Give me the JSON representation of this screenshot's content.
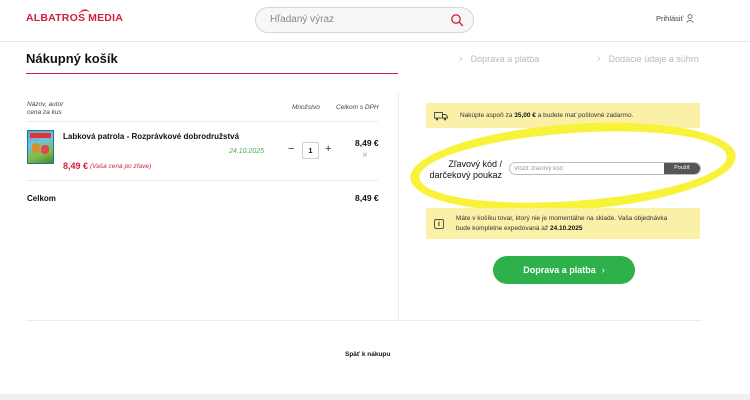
{
  "header": {
    "logo_word1": "ALBATROS",
    "logo_word2": "MEDIA",
    "search_placeholder": "Hľadaný výraz",
    "login_label": "Prihlásiť"
  },
  "steps": {
    "current": "Nákupný košík",
    "step2": "Doprava a platba",
    "step3": "Dodacie údaje a súhrn"
  },
  "cart": {
    "headers": {
      "name": "Názov, autor",
      "name_line2": "cena za kus",
      "qty": "Množstvo",
      "total": "Celkom s DPH"
    },
    "item": {
      "title": "Labková patrola - Rozprávkové dobrodružstvá",
      "date": "24.10.2025",
      "price": "8,49 €",
      "price_note": "(Vaša cena po zľave)",
      "quantity": "1",
      "total": "8,49 €"
    },
    "sum_label": "Celkom",
    "sum_value": "8,49 €"
  },
  "panel": {
    "ship_prefix": "Nakúpte aspoň za",
    "ship_amount": "35,00 €",
    "ship_suffix": "a budete mať poštovné zadarmo.",
    "coupon_label_line1": "Zľavový kód /",
    "coupon_label_line2": "darčekový poukaz",
    "coupon_placeholder": "Vložiť zľavový kód",
    "coupon_button": "Použiť",
    "stock_line1": "Máte v košíku tovar, ktorý nie je momentálne na sklade. Vaša objednávka",
    "stock_line2_prefix": "bude kompletne expedovaná až",
    "stock_date": "24.10.2025",
    "checkout_button": "Doprava a platba"
  },
  "footer": {
    "back_link": "Späť k nákupu"
  },
  "colors": {
    "brand_red": "#d21f3c",
    "checkout_green": "#2eb04a",
    "banner_yellow": "#fbf0a8",
    "highlight_yellow": "#f8f33a"
  },
  "icons": [
    "logo-wing-icon",
    "search-icon",
    "user-icon",
    "chevron-right-icon",
    "truck-icon",
    "info-icon",
    "close-icon",
    "minus-icon",
    "plus-icon"
  ]
}
